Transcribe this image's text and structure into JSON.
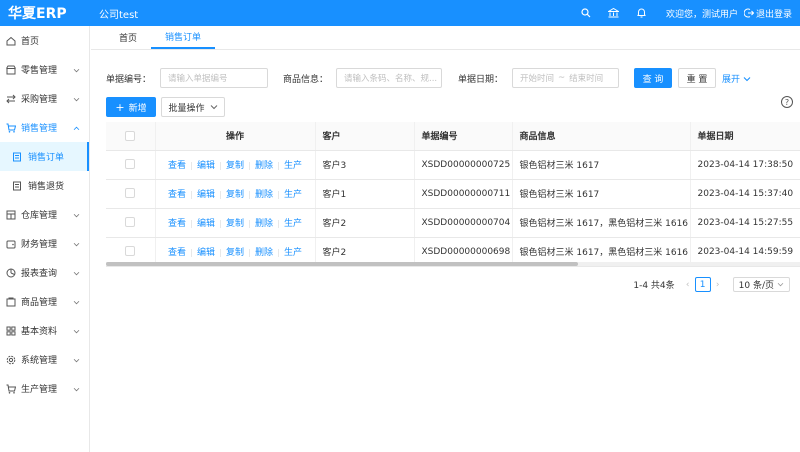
{
  "header": {
    "logo": "华夏ERP",
    "company": "公司test",
    "welcome": "欢迎您，测试用户",
    "logout": "退出登录"
  },
  "sidebar": {
    "items": [
      {
        "label": "首页",
        "icon": "home-icon"
      },
      {
        "label": "零售管理",
        "icon": "shop-icon"
      },
      {
        "label": "采购管理",
        "icon": "swap-icon"
      },
      {
        "label": "销售管理",
        "icon": "cart-icon",
        "open": true
      },
      {
        "label": "销售订单",
        "icon": "order-icon",
        "sub": true,
        "active": true
      },
      {
        "label": "销售退货",
        "icon": "order-icon",
        "sub": true
      },
      {
        "label": "仓库管理",
        "icon": "warehouse-icon"
      },
      {
        "label": "财务管理",
        "icon": "wallet-icon"
      },
      {
        "label": "报表查询",
        "icon": "chart-icon"
      },
      {
        "label": "商品管理",
        "icon": "goods-icon"
      },
      {
        "label": "基本资料",
        "icon": "grid-icon"
      },
      {
        "label": "系统管理",
        "icon": "setting-icon"
      },
      {
        "label": "生产管理",
        "icon": "cart-icon"
      }
    ]
  },
  "tabs": [
    {
      "label": "首页"
    },
    {
      "label": "销售订单",
      "active": true
    }
  ],
  "search": {
    "bill_no_label": "单据编号：",
    "bill_no_placeholder": "请输入单据编号",
    "goods_label": "商品信息：",
    "goods_placeholder": "请输入条码、名称、规...",
    "date_label": "单据日期：",
    "date_start": "开始时间",
    "date_sep": "~",
    "date_end": "结束时间",
    "query": "查 询",
    "reset": "重 置",
    "expand": "展开"
  },
  "toolbar": {
    "add": "新增",
    "batch": "批量操作"
  },
  "table": {
    "columns": [
      "操作",
      "客户",
      "单据编号",
      "商品信息",
      "单据日期"
    ],
    "actions": [
      "查看",
      "编辑",
      "复制",
      "删除",
      "生产"
    ],
    "rows": [
      {
        "customer": "客户3",
        "bill_no": "XSDD00000000725",
        "goods": "银色铝材三米 1617",
        "date": "2023-04-14 17:38:50"
      },
      {
        "customer": "客户1",
        "bill_no": "XSDD00000000711",
        "goods": "银色铝材三米 1617",
        "date": "2023-04-14 15:37:40"
      },
      {
        "customer": "客户2",
        "bill_no": "XSDD00000000704",
        "goods": "银色铝材三米 1617，黑色铝材三米 1616",
        "date": "2023-04-14 15:27:55"
      },
      {
        "customer": "客户2",
        "bill_no": "XSDD00000000698",
        "goods": "银色铝材三米 1617，黑色铝材三米 1616",
        "date": "2023-04-14 14:59:59"
      }
    ]
  },
  "pagination": {
    "summary": "1-4 共4条",
    "current": "1",
    "page_size": "10 条/页"
  },
  "colors": {
    "primary": "#1890ff",
    "border": "#e8e8e8"
  }
}
